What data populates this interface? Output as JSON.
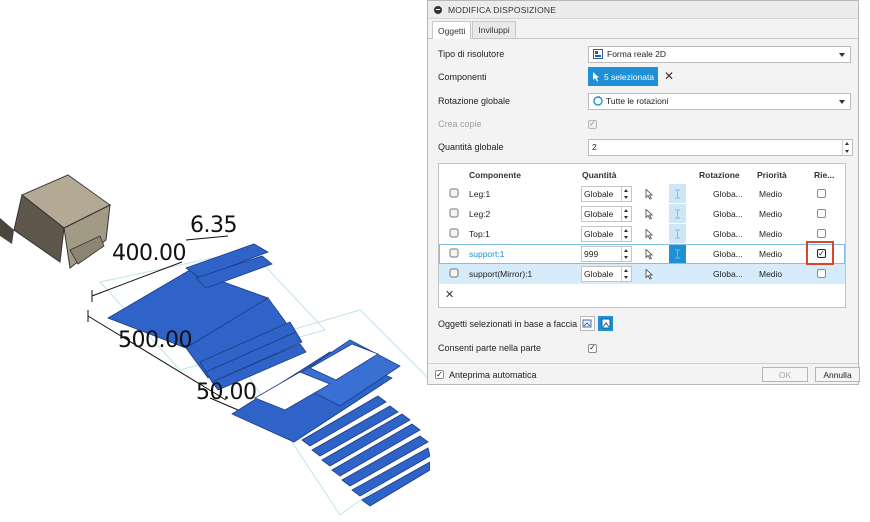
{
  "scene": {
    "dimensions": [
      "6.35",
      "400.00",
      "500.00",
      "50.00"
    ]
  },
  "dialog": {
    "title": "MODIFICA DISPOSIZIONE",
    "tabs": [
      {
        "label": "Oggetti",
        "active": true
      },
      {
        "label": "Inviluppi",
        "active": false
      }
    ],
    "solver_type": {
      "label": "Tipo di risolutore",
      "value": "Forma reale 2D"
    },
    "components": {
      "label": "Componenti",
      "button": "5 selezionata"
    },
    "global_rotation": {
      "label": "Rotazione globale",
      "value": "Tutte le rotazioni"
    },
    "create_copies": {
      "label": "Crea copie",
      "checked": true,
      "enabled": false
    },
    "global_quantity": {
      "label": "Quantità globale",
      "value": "2"
    },
    "table": {
      "headers": {
        "component": "Componente",
        "quantity": "Quantità",
        "rotation": "Rotazione",
        "priority": "Priorità",
        "fill": "Rie..."
      },
      "rows": [
        {
          "name": "Leg:1",
          "quantity": "Globale",
          "rotation": "Globa...",
          "priority": "Medio",
          "checked": false
        },
        {
          "name": "Leg:2",
          "quantity": "Globale",
          "rotation": "Globa...",
          "priority": "Medio",
          "checked": false
        },
        {
          "name": "Top:1",
          "quantity": "Globale",
          "rotation": "Globa...",
          "priority": "Medio",
          "checked": false
        },
        {
          "name": "support:1",
          "quantity": "999",
          "rotation": "Globa...",
          "priority": "Medio",
          "checked": true
        },
        {
          "name": "support(Mirror):1",
          "quantity": "Globale",
          "rotation": "Globa...",
          "priority": "Medio",
          "checked": false
        }
      ],
      "remove_icon": "close-icon"
    },
    "face_objects": {
      "label": "Oggetti selezionati in base a faccia"
    },
    "part_in_part": {
      "label": "Consenti parte nella parte",
      "checked": true
    },
    "auto_preview": {
      "label": "Anteprima automatica",
      "checked": true
    },
    "ok_label": "OK",
    "cancel_label": "Annulla",
    "colors": {
      "accent": "#1f8fd6",
      "selection": "#d7ecfa",
      "highlight": "#d9472b",
      "part_blue": "#2f63c8"
    }
  }
}
